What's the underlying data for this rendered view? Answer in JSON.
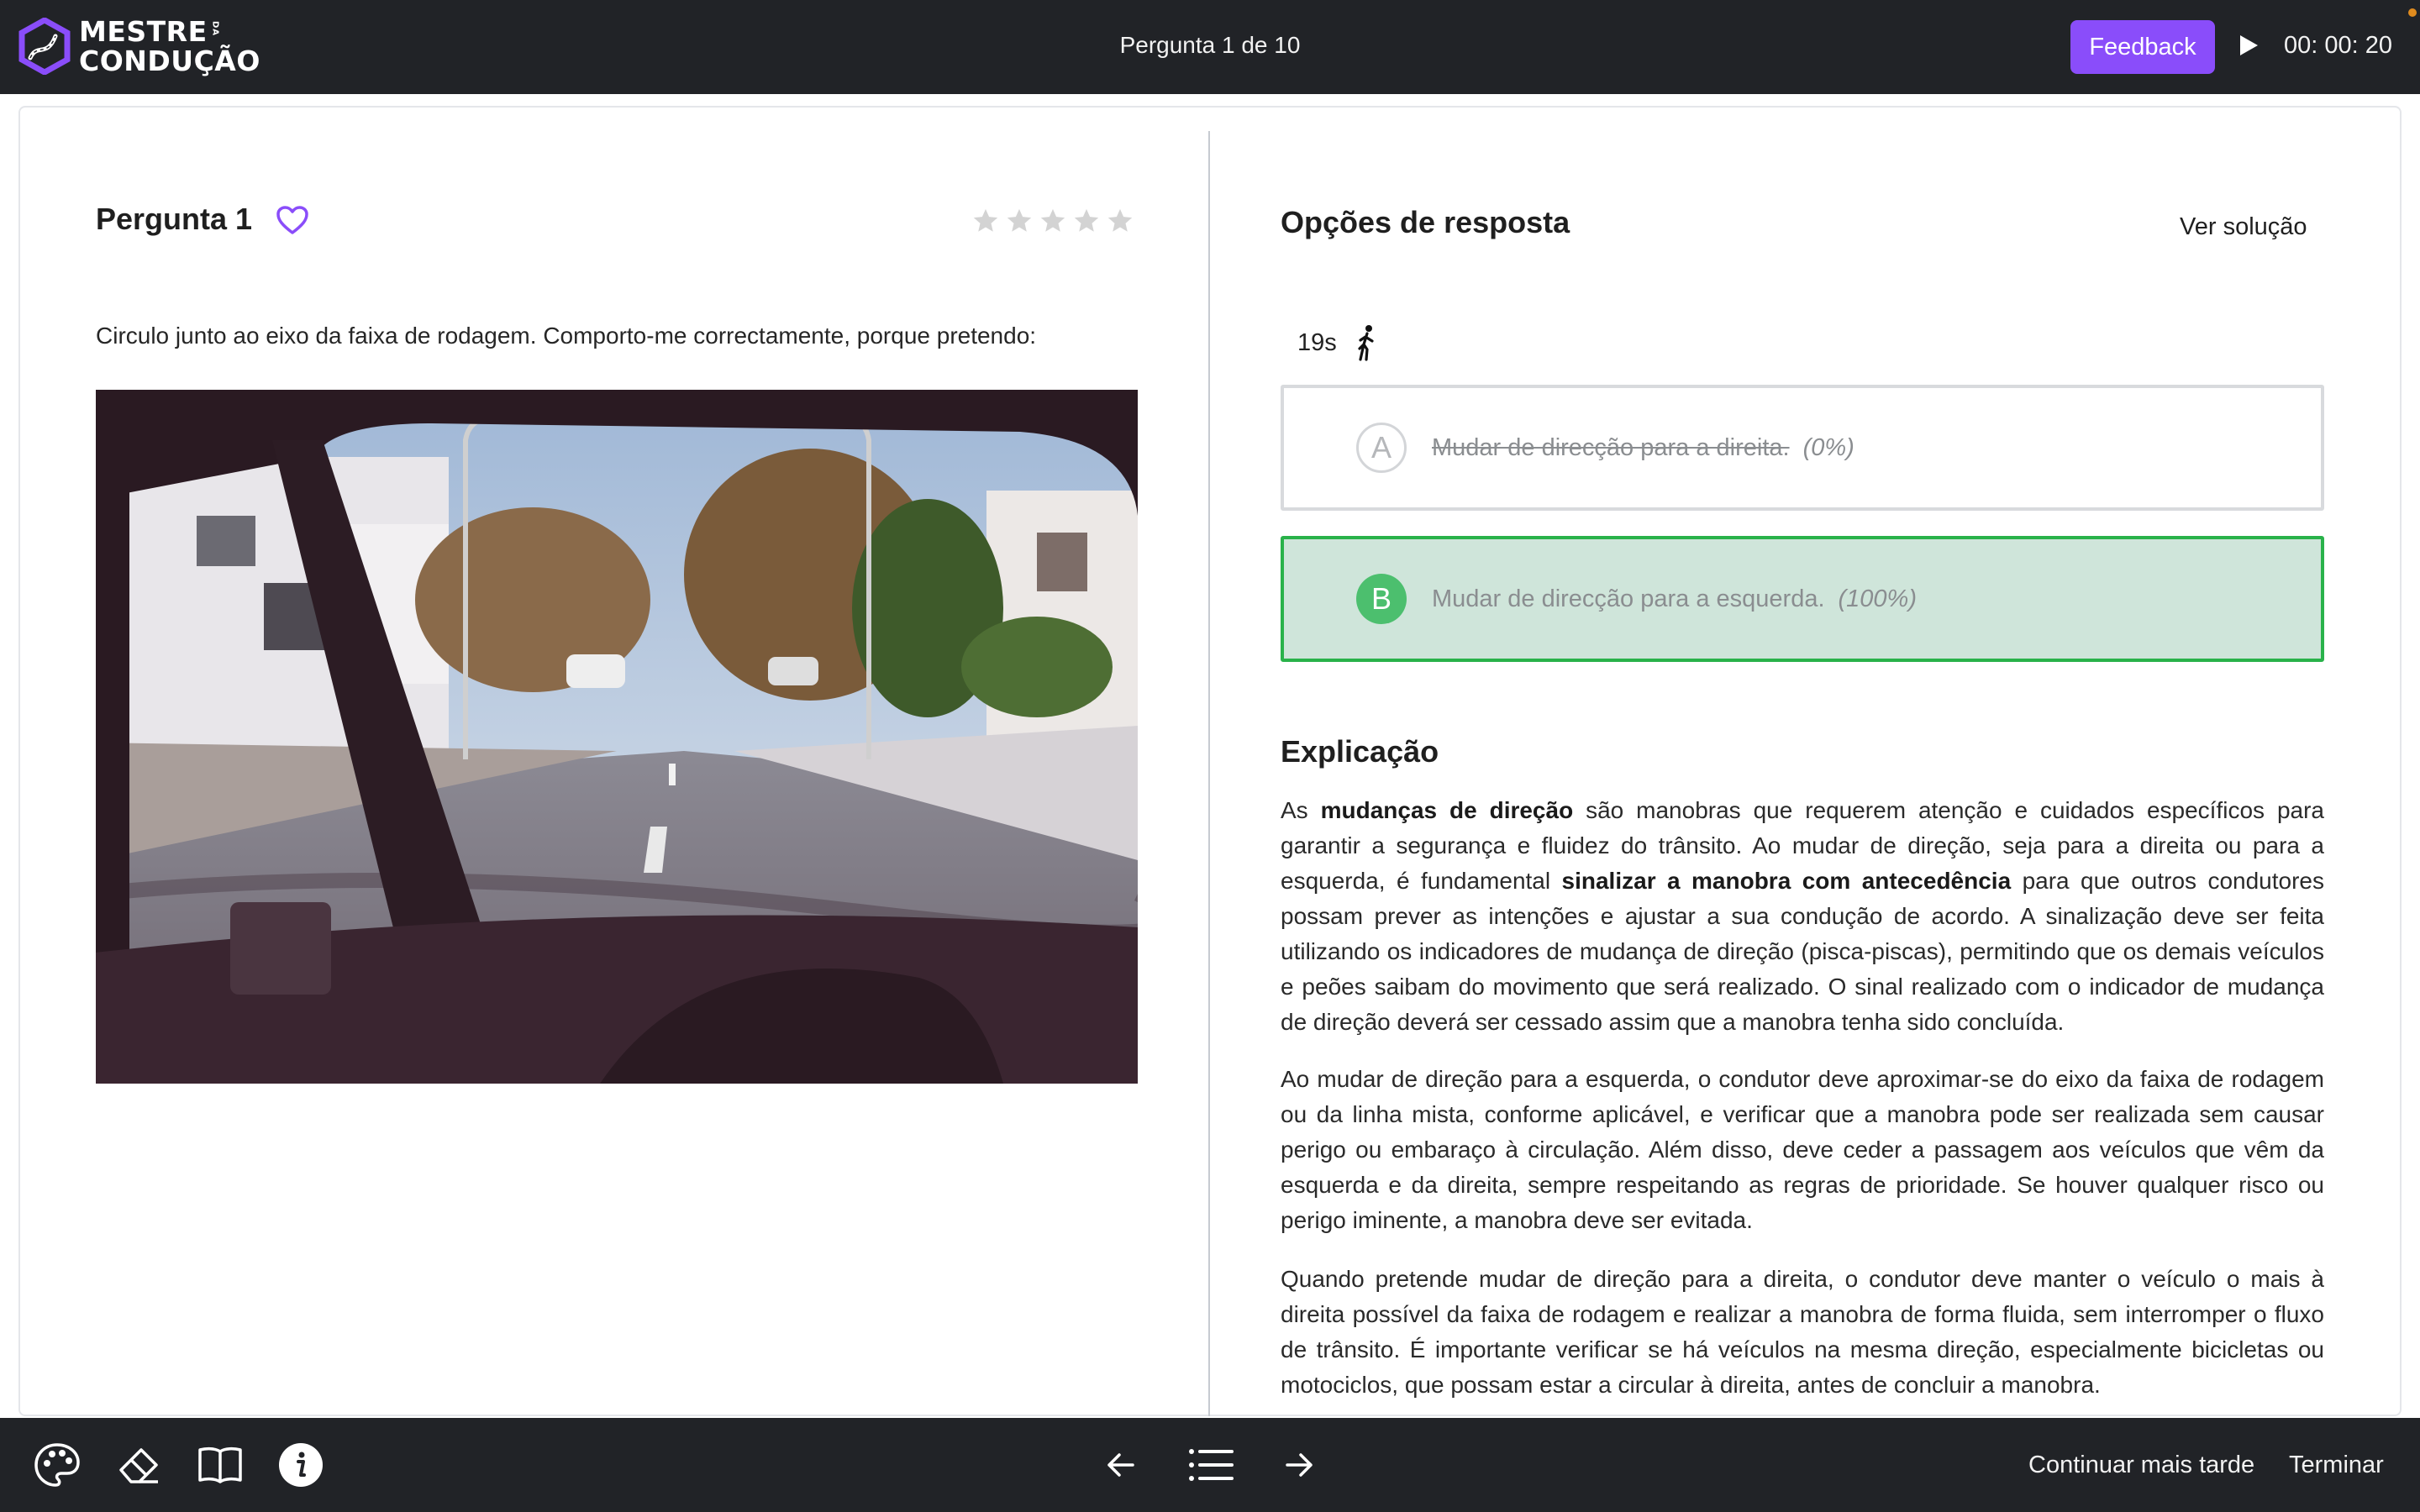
{
  "header": {
    "logo_line1": "MESTRE",
    "logo_sub": "DA",
    "logo_line2": "CONDUÇÃO",
    "question_counter": "Pergunta 1 de 10",
    "feedback_label": "Feedback",
    "timer": "00: 00: 20"
  },
  "question": {
    "title": "Pergunta 1",
    "rating_stars": 5,
    "rating_value": 0,
    "text": "Circulo junto ao eixo da faixa de rodagem. Comporto-me correctamente, porque pretendo:"
  },
  "answers": {
    "title": "Opções de resposta",
    "see_solution_label": "Ver solução",
    "time_left": "19s",
    "options": [
      {
        "letter": "A",
        "text": "Mudar de direcção para a direita.",
        "percent": "(0%)"
      },
      {
        "letter": "B",
        "text": "Mudar de direcção para a esquerda.",
        "percent": "(100%)"
      }
    ]
  },
  "explanation": {
    "title": "Explicação",
    "p1": [
      "As ",
      "mudanças de direção",
      " são manobras que requerem atenção e cuidados específicos para garantir a segurança e fluidez do trânsito. Ao mudar de direção, seja para a direita ou para a esquerda, é fundamental ",
      "sinalizar a manobra com antecedência",
      " para que outros condutores possam prever as intenções e ajustar a sua condução de acordo. A sinalização deve ser feita utilizando os indicadores de mudança de direção (pisca-piscas), permitindo que os demais veículos e peões saibam do movimento que será realizado. O sinal realizado com o indicador de mudança de direção deverá ser cessado assim que a manobra tenha sido concluída."
    ],
    "p2": "Ao mudar de direção para a esquerda, o condutor deve aproximar-se do eixo da faixa de rodagem ou da linha mista, conforme aplicável, e verificar que a manobra pode ser realizada sem causar perigo ou embaraço à circulação. Além disso, deve ceder a passagem aos veículos que vêm da esquerda e da direita, sempre respeitando as regras de prioridade. Se houver qualquer risco ou perigo iminente, a manobra deve ser evitada.",
    "p3": "Quando pretende mudar de direção para a direita, o condutor deve manter o veículo o mais à direita possível da faixa de rodagem e realizar a manobra de forma fluida, sem interromper o fluxo de trânsito. É importante verificar se há veículos na mesma direção, especialmente bicicletas ou motociclos, que possam estar a circular à direita, antes de concluir a manobra."
  },
  "footer": {
    "continue_later_label": "Continuar mais tarde",
    "finish_label": "Terminar"
  },
  "icons": {
    "heart": "heart-icon",
    "star": "star-icon",
    "walk": "walking-person-icon",
    "play": "play-icon",
    "palette": "palette-icon",
    "eraser": "eraser-icon",
    "book": "book-icon",
    "info": "info-icon",
    "arrow_left": "arrow-left-icon",
    "list": "list-icon",
    "arrow_right": "arrow-right-icon"
  },
  "colors": {
    "accent": "#8a4dfa",
    "correct_border": "#29b24a",
    "correct_bg": "#cfe5da",
    "bar_bg": "#212327"
  }
}
